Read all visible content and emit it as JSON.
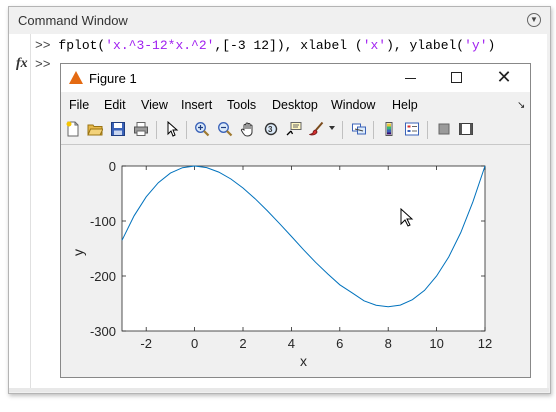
{
  "command_window": {
    "title": "Command Window",
    "prompt": ">>",
    "fx_label": "fx",
    "command": {
      "p1": "fplot(",
      "s1": "'x.^3-12*x.^2'",
      "p2": ",[-3 12]), xlabel (",
      "s2": "'x'",
      "p3": "), ylabel(",
      "s3": "'y'",
      "p4": ")"
    },
    "prompt2": ">>"
  },
  "figure": {
    "title": "Figure 1",
    "menus": [
      "File",
      "Edit",
      "View",
      "Insert",
      "Tools",
      "Desktop",
      "Window",
      "Help"
    ],
    "toolbar_icons": [
      "new-figure-icon",
      "open-icon",
      "save-icon",
      "print-icon",
      "pointer-icon",
      "zoom-in-icon",
      "zoom-out-icon",
      "pan-icon",
      "rotate-icon",
      "data-cursor-icon",
      "brush-icon",
      "link-icon",
      "colorbar-icon",
      "legend-icon",
      "hide-plot-tools-icon",
      "show-plot-tools-icon"
    ]
  },
  "chart_data": {
    "type": "line",
    "function": "x.^3-12*x.^2",
    "xlim": [
      -3,
      12
    ],
    "ylim": [
      -300,
      0
    ],
    "xticks": [
      -2,
      0,
      2,
      4,
      6,
      8,
      10,
      12
    ],
    "yticks": [
      0,
      -100,
      -200,
      -300
    ],
    "xlabel": "x",
    "ylabel": "y",
    "line_color": "#0072bd",
    "series": [
      {
        "x": [
          -3,
          -2.5,
          -2,
          -1.5,
          -1,
          -0.5,
          0,
          0.5,
          1,
          1.5,
          2,
          2.5,
          3,
          3.5,
          4,
          4.5,
          5,
          5.5,
          6,
          6.5,
          7,
          7.5,
          8,
          8.5,
          9,
          9.5,
          10,
          10.5,
          11,
          11.5,
          12
        ],
        "y": [
          -135,
          -90.6,
          -56,
          -30.4,
          -13,
          -3.1,
          0,
          -2.9,
          -11,
          -23.6,
          -40,
          -59.4,
          -81,
          -104.1,
          -128,
          -152.1,
          -175,
          -196.1,
          -216,
          -230.4,
          -245,
          -253.1,
          -256,
          -252.9,
          -243,
          -226.1,
          -200,
          -165.4,
          -121,
          -65.1,
          0
        ]
      }
    ],
    "grid": false
  }
}
